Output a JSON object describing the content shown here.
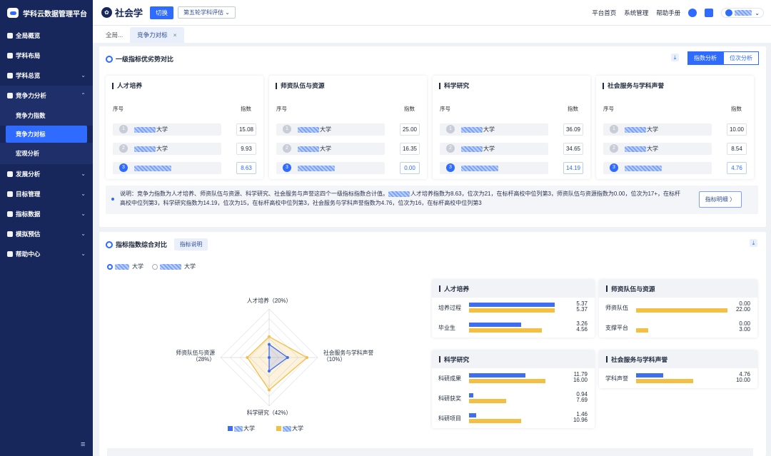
{
  "app": {
    "title": "学科云数据管理平台"
  },
  "sidebar": {
    "items": [
      {
        "label": "全局概览"
      },
      {
        "label": "学科布局"
      },
      {
        "label": "学科总览"
      },
      {
        "label": "竞争力分析"
      },
      {
        "label": "竞争力指数"
      },
      {
        "label": "竞争力对标"
      },
      {
        "label": "宏观分析"
      },
      {
        "label": "发展分析"
      },
      {
        "label": "目标管理"
      },
      {
        "label": "指标数据"
      },
      {
        "label": "模拟预估"
      },
      {
        "label": "帮助中心"
      }
    ]
  },
  "topbar": {
    "school": "社会学",
    "switch_label": "切换",
    "round_select": "第五轮学科评估",
    "links": [
      "平台首页",
      "系统管理",
      "帮助手册"
    ]
  },
  "tabs": [
    {
      "label": "全局..."
    },
    {
      "label": "竞争力对标"
    }
  ],
  "section1": {
    "title": "一级指标优劣势对比",
    "seg": [
      "指数分析",
      "位次分析"
    ],
    "col_no": "序号",
    "col_val": "指数",
    "boxes": [
      {
        "title": "人才培养",
        "rows": [
          {
            "no": "1",
            "suffix": "大学",
            "val": "15.08"
          },
          {
            "no": "2",
            "suffix": "大学",
            "val": "9.93"
          },
          {
            "no": "3",
            "suffix": "",
            "val": "8.63"
          }
        ]
      },
      {
        "title": "师资队伍与资源",
        "rows": [
          {
            "no": "1",
            "suffix": "大学",
            "val": "25.00"
          },
          {
            "no": "2",
            "suffix": "大学",
            "val": "16.35"
          },
          {
            "no": "3",
            "suffix": "",
            "val": "0.00"
          }
        ]
      },
      {
        "title": "科学研究",
        "rows": [
          {
            "no": "1",
            "suffix": "大学",
            "val": "36.09"
          },
          {
            "no": "2",
            "suffix": "大学",
            "val": "34.65"
          },
          {
            "no": "3",
            "suffix": "",
            "val": "14.19"
          }
        ]
      },
      {
        "title": "社会服务与学科声誉",
        "rows": [
          {
            "no": "1",
            "suffix": "大学",
            "val": "10.00"
          },
          {
            "no": "2",
            "suffix": "大学",
            "val": "8.54"
          },
          {
            "no": "3",
            "suffix": "",
            "val": "4.76"
          }
        ]
      }
    ],
    "note_a": "说明：竞争力指数为人才培养、师资队伍与资源、科学研究、社会服务与声誉这四个一级指标指数合计值。",
    "note_b": "人才培养指数为8.63，位次为21，在标杆高校中位列第3，师资队伍与资源指数为0.00，位次为17+，在标杆高校中位列第3，科学研究指数为14.19，位次为15，在标杆高校中位列第3，社会服务与学科声誉指数为4.76，位次为16，在标杆高校中位列第3",
    "detail_button": "指标明细 〉"
  },
  "section2": {
    "title": "指标指数综合对比",
    "help_button": "指标说明",
    "radios": [
      {
        "suffix": "大学"
      },
      {
        "suffix": "大学"
      }
    ],
    "legend": [
      {
        "suffix": "大学",
        "color": "#3f6ef0"
      },
      {
        "suffix": "大学",
        "color": "#f3bf45"
      }
    ]
  },
  "chart_data": [
    {
      "type": "radar",
      "axes": [
        {
          "label": "人才培养（20%）"
        },
        {
          "label": "社会服务与学科声誉（10%）"
        },
        {
          "label": "科学研究（42%）"
        },
        {
          "label": "师资队伍与资源（28%）"
        }
      ],
      "series": [
        {
          "name": "blue",
          "values": [
            0.27,
            0.38,
            0.28,
            0.0
          ],
          "color": "#3f6ef0"
        },
        {
          "name": "yellow",
          "values": [
            0.43,
            0.78,
            0.67,
            0.45
          ],
          "color": "#f3bf45"
        }
      ]
    },
    {
      "type": "bar",
      "groups": [
        {
          "title": "人才培养",
          "max": 6.0,
          "rows": [
            {
              "label": "培养过程",
              "a": "5.37",
              "b": "5.37"
            },
            {
              "label": "毕业生",
              "a": "3.26",
              "b": "4.56"
            }
          ]
        },
        {
          "title": "师资队伍与资源",
          "max": 22.0,
          "rows": [
            {
              "label": "师资队伍",
              "a": "0.00",
              "b": "22.00"
            },
            {
              "label": "支撑平台",
              "a": "0.00",
              "b": "3.00"
            }
          ]
        },
        {
          "title": "科学研究",
          "max": 20.0,
          "rows": [
            {
              "label": "科研成果",
              "a": "11.79",
              "b": "16.00"
            },
            {
              "label": "科研获奖",
              "a": "0.94",
              "b": "7.69"
            },
            {
              "label": "科研项目",
              "a": "1.46",
              "b": "10.96"
            }
          ]
        },
        {
          "title": "社会服务与学科声誉",
          "max": 16.0,
          "rows": [
            {
              "label": "学科声誉",
              "a": "4.76",
              "b": "10.00"
            }
          ]
        }
      ]
    }
  ]
}
